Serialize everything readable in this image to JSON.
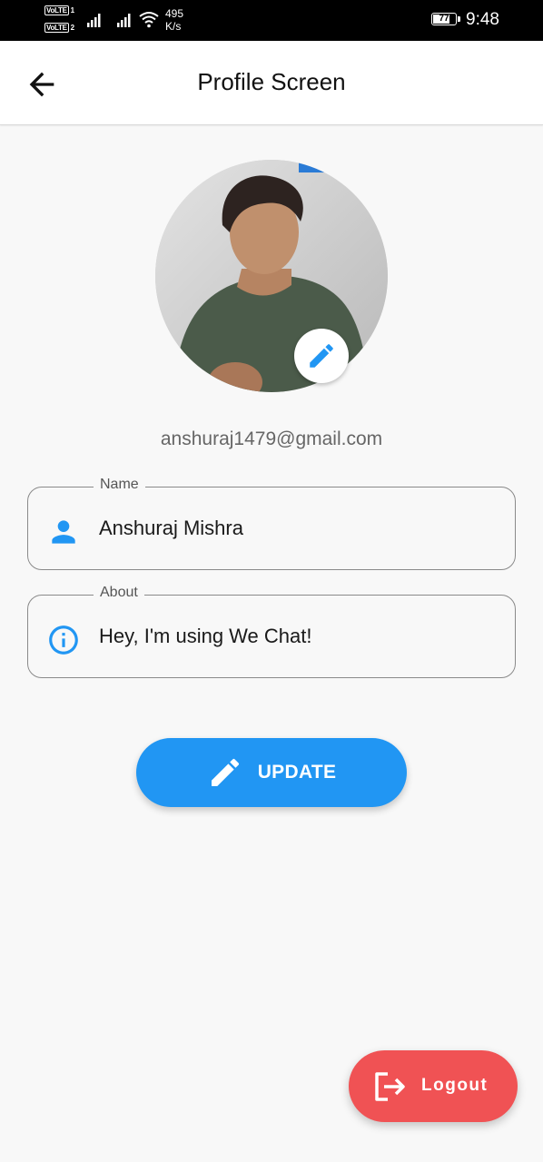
{
  "status_bar": {
    "volte_1": "VoLTE",
    "sim_1": "1",
    "volte_2": "VoLTE",
    "sim_2": "2",
    "net_speed_value": "495",
    "net_speed_unit": "K/s",
    "battery_level": "77",
    "time": "9:48"
  },
  "app_bar": {
    "title": "Profile Screen",
    "back_icon": "arrow-back"
  },
  "profile": {
    "avatar_icon": "profile-photo",
    "edit_icon": "pencil",
    "email": "anshuraj1479@gmail.com"
  },
  "fields": {
    "name": {
      "label": "Name",
      "value": "Anshuraj Mishra",
      "icon": "person"
    },
    "about": {
      "label": "About",
      "value": "Hey, I'm using We Chat!",
      "icon": "info-outline"
    }
  },
  "update_button": {
    "label": "UPDATE",
    "icon": "pencil"
  },
  "logout_button": {
    "label": "Logout",
    "icon": "logout"
  },
  "colors": {
    "primary": "#2196F3",
    "logout": "#F05254",
    "background": "#F8F8F8"
  }
}
